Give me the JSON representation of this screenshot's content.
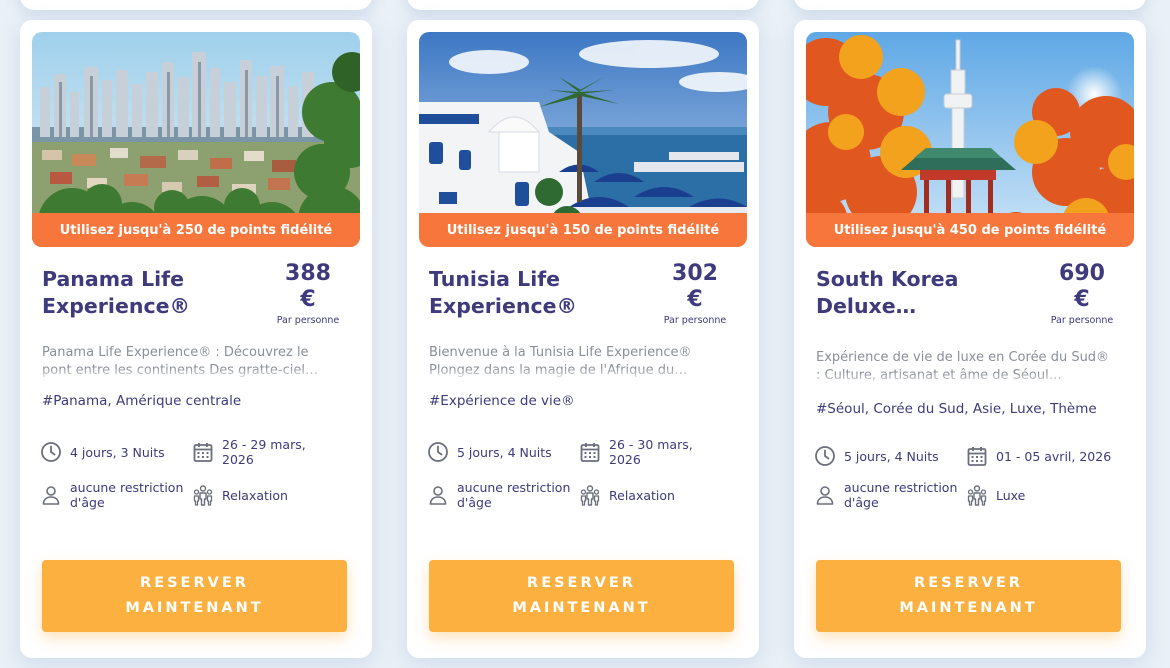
{
  "cards": [
    {
      "points_banner": "Utilisez jusqu'à 250 de points fidélité",
      "title": "Panama Life Experience®",
      "price": "388",
      "currency": "€",
      "per_person": "Par personne",
      "description": "Panama Life Experience® : Découvrez le pont entre les continents Des gratte-ciel…",
      "tags": "#Panama, Amérique centrale",
      "duration": "4 jours, 3 Nuits",
      "dates": "26 - 29 mars, 2026",
      "age": "aucune restriction d'âge",
      "theme": "Relaxation",
      "button": "RESERVER MAINTENANT",
      "image_icon": "panama-city-skyline-photo"
    },
    {
      "points_banner": "Utilisez jusqu'à 150 de points fidélité",
      "title": "Tunisia Life Experience®",
      "price": "302",
      "currency": "€",
      "per_person": "Par personne",
      "description": "Bienvenue à la Tunisia Life Experience® Plongez dans la magie de l'Afrique du…",
      "tags": "#Expérience de vie®",
      "duration": "5 jours, 4 Nuits",
      "dates": "26 - 30 mars, 2026",
      "age": "aucune restriction d'âge",
      "theme": "Relaxation",
      "button": "RESERVER MAINTENANT",
      "image_icon": "sidi-bou-said-coast-photo"
    },
    {
      "points_banner": "Utilisez jusqu'à 450 de points fidélité",
      "title": "South Korea Deluxe…",
      "price": "690",
      "currency": "€",
      "per_person": "Par personne",
      "description": "Expérience de vie de luxe en Corée du Sud® : Culture, artisanat et âme de Séoul…",
      "tags": "#Séoul, Corée du Sud, Asie, Luxe, Thème",
      "duration": "5 jours, 4 Nuits",
      "dates": "01 - 05 avril, 2026",
      "age": "aucune restriction d'âge",
      "theme": "Luxe",
      "button": "RESERVER MAINTENANT",
      "image_icon": "seoul-tower-autumn-photo"
    }
  ],
  "colors": {
    "accent_orange": "#f7763c",
    "button_yellow": "#fbb040",
    "title_navy": "#3e3a7c",
    "page_background": "#e9f0f7"
  }
}
